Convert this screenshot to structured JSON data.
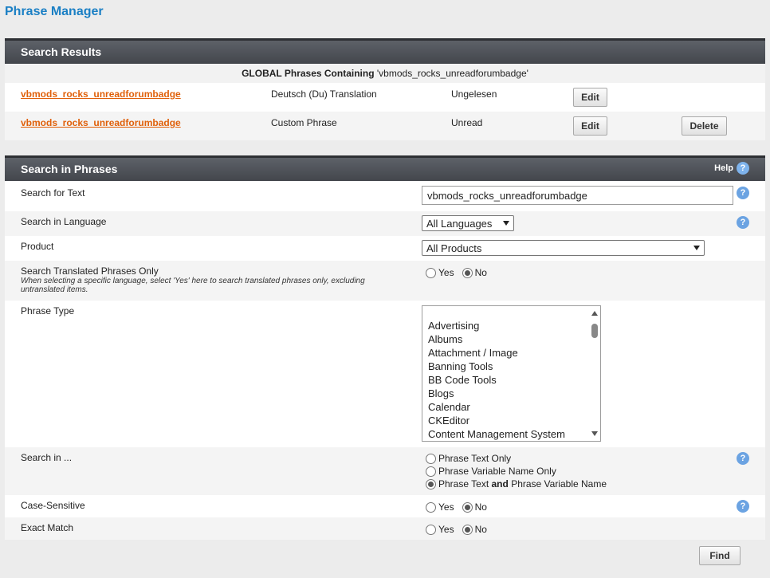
{
  "page_title": "Phrase Manager",
  "results": {
    "header": "Search Results",
    "subheader_bold": "GLOBAL Phrases Containing",
    "subheader_term": "'vbmods_rocks_unreadforumbadge'",
    "rows": [
      {
        "varname": "vbmods_rocks_unreadforumbadge",
        "type": "Deutsch (Du) Translation",
        "text": "Ungelesen",
        "edit_label": "Edit"
      },
      {
        "varname": "vbmods_rocks_unreadforumbadge",
        "type": "Custom Phrase",
        "text": "Unread",
        "edit_label": "Edit",
        "delete_label": "Delete"
      }
    ]
  },
  "search": {
    "header": "Search in Phrases",
    "help_label": "Help",
    "help_icon_glyph": "?",
    "text_label": "Search for Text",
    "text_value": "vbmods_rocks_unreadforumbadge",
    "language_label": "Search in Language",
    "language_value": "All Languages",
    "product_label": "Product",
    "product_value": "All Products",
    "translated_label": "Search Translated Phrases Only",
    "translated_desc": "When selecting a specific language, select 'Yes' here to search translated phrases only, excluding untranslated items.",
    "yes_label": "Yes",
    "no_label": "No",
    "phrase_type_label": "Phrase Type",
    "phrase_types": [
      "Advertising",
      "Albums",
      "Attachment / Image",
      "Banning Tools",
      "BB Code Tools",
      "Blogs",
      "Calendar",
      "CKEditor",
      "Content Management System"
    ],
    "search_in_label": "Search in ...",
    "search_in_opt1": "Phrase Text Only",
    "search_in_opt2": "Phrase Variable Name Only",
    "search_in_opt3_a": "Phrase Text",
    "search_in_opt3_and": "and",
    "search_in_opt3_b": "Phrase Variable Name",
    "case_label": "Case-Sensitive",
    "exact_label": "Exact Match",
    "find_label": "Find"
  }
}
